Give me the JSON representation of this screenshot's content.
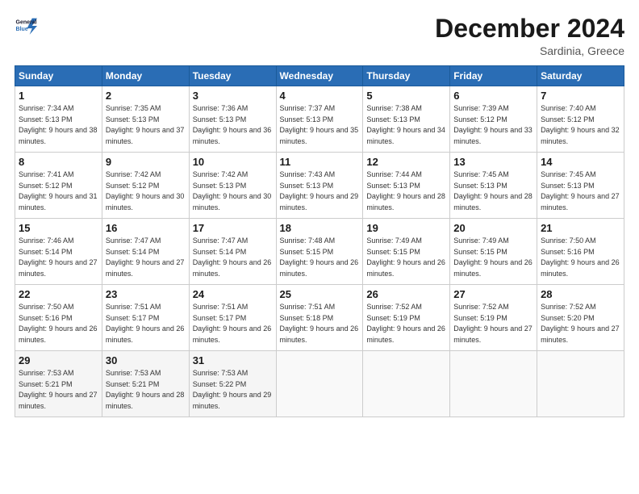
{
  "header": {
    "logo_line1": "General",
    "logo_line2": "Blue",
    "month": "December 2024",
    "location": "Sardinia, Greece"
  },
  "weekdays": [
    "Sunday",
    "Monday",
    "Tuesday",
    "Wednesday",
    "Thursday",
    "Friday",
    "Saturday"
  ],
  "weeks": [
    [
      {
        "day": "1",
        "sunrise": "7:34 AM",
        "sunset": "5:13 PM",
        "daylight": "9 hours and 38 minutes."
      },
      {
        "day": "2",
        "sunrise": "7:35 AM",
        "sunset": "5:13 PM",
        "daylight": "9 hours and 37 minutes."
      },
      {
        "day": "3",
        "sunrise": "7:36 AM",
        "sunset": "5:13 PM",
        "daylight": "9 hours and 36 minutes."
      },
      {
        "day": "4",
        "sunrise": "7:37 AM",
        "sunset": "5:13 PM",
        "daylight": "9 hours and 35 minutes."
      },
      {
        "day": "5",
        "sunrise": "7:38 AM",
        "sunset": "5:13 PM",
        "daylight": "9 hours and 34 minutes."
      },
      {
        "day": "6",
        "sunrise": "7:39 AM",
        "sunset": "5:12 PM",
        "daylight": "9 hours and 33 minutes."
      },
      {
        "day": "7",
        "sunrise": "7:40 AM",
        "sunset": "5:12 PM",
        "daylight": "9 hours and 32 minutes."
      }
    ],
    [
      {
        "day": "8",
        "sunrise": "7:41 AM",
        "sunset": "5:12 PM",
        "daylight": "9 hours and 31 minutes."
      },
      {
        "day": "9",
        "sunrise": "7:42 AM",
        "sunset": "5:12 PM",
        "daylight": "9 hours and 30 minutes."
      },
      {
        "day": "10",
        "sunrise": "7:42 AM",
        "sunset": "5:13 PM",
        "daylight": "9 hours and 30 minutes."
      },
      {
        "day": "11",
        "sunrise": "7:43 AM",
        "sunset": "5:13 PM",
        "daylight": "9 hours and 29 minutes."
      },
      {
        "day": "12",
        "sunrise": "7:44 AM",
        "sunset": "5:13 PM",
        "daylight": "9 hours and 28 minutes."
      },
      {
        "day": "13",
        "sunrise": "7:45 AM",
        "sunset": "5:13 PM",
        "daylight": "9 hours and 28 minutes."
      },
      {
        "day": "14",
        "sunrise": "7:45 AM",
        "sunset": "5:13 PM",
        "daylight": "9 hours and 27 minutes."
      }
    ],
    [
      {
        "day": "15",
        "sunrise": "7:46 AM",
        "sunset": "5:14 PM",
        "daylight": "9 hours and 27 minutes."
      },
      {
        "day": "16",
        "sunrise": "7:47 AM",
        "sunset": "5:14 PM",
        "daylight": "9 hours and 27 minutes."
      },
      {
        "day": "17",
        "sunrise": "7:47 AM",
        "sunset": "5:14 PM",
        "daylight": "9 hours and 26 minutes."
      },
      {
        "day": "18",
        "sunrise": "7:48 AM",
        "sunset": "5:15 PM",
        "daylight": "9 hours and 26 minutes."
      },
      {
        "day": "19",
        "sunrise": "7:49 AM",
        "sunset": "5:15 PM",
        "daylight": "9 hours and 26 minutes."
      },
      {
        "day": "20",
        "sunrise": "7:49 AM",
        "sunset": "5:15 PM",
        "daylight": "9 hours and 26 minutes."
      },
      {
        "day": "21",
        "sunrise": "7:50 AM",
        "sunset": "5:16 PM",
        "daylight": "9 hours and 26 minutes."
      }
    ],
    [
      {
        "day": "22",
        "sunrise": "7:50 AM",
        "sunset": "5:16 PM",
        "daylight": "9 hours and 26 minutes."
      },
      {
        "day": "23",
        "sunrise": "7:51 AM",
        "sunset": "5:17 PM",
        "daylight": "9 hours and 26 minutes."
      },
      {
        "day": "24",
        "sunrise": "7:51 AM",
        "sunset": "5:17 PM",
        "daylight": "9 hours and 26 minutes."
      },
      {
        "day": "25",
        "sunrise": "7:51 AM",
        "sunset": "5:18 PM",
        "daylight": "9 hours and 26 minutes."
      },
      {
        "day": "26",
        "sunrise": "7:52 AM",
        "sunset": "5:19 PM",
        "daylight": "9 hours and 26 minutes."
      },
      {
        "day": "27",
        "sunrise": "7:52 AM",
        "sunset": "5:19 PM",
        "daylight": "9 hours and 27 minutes."
      },
      {
        "day": "28",
        "sunrise": "7:52 AM",
        "sunset": "5:20 PM",
        "daylight": "9 hours and 27 minutes."
      }
    ],
    [
      {
        "day": "29",
        "sunrise": "7:53 AM",
        "sunset": "5:21 PM",
        "daylight": "9 hours and 27 minutes."
      },
      {
        "day": "30",
        "sunrise": "7:53 AM",
        "sunset": "5:21 PM",
        "daylight": "9 hours and 28 minutes."
      },
      {
        "day": "31",
        "sunrise": "7:53 AM",
        "sunset": "5:22 PM",
        "daylight": "9 hours and 29 minutes."
      },
      null,
      null,
      null,
      null
    ]
  ]
}
